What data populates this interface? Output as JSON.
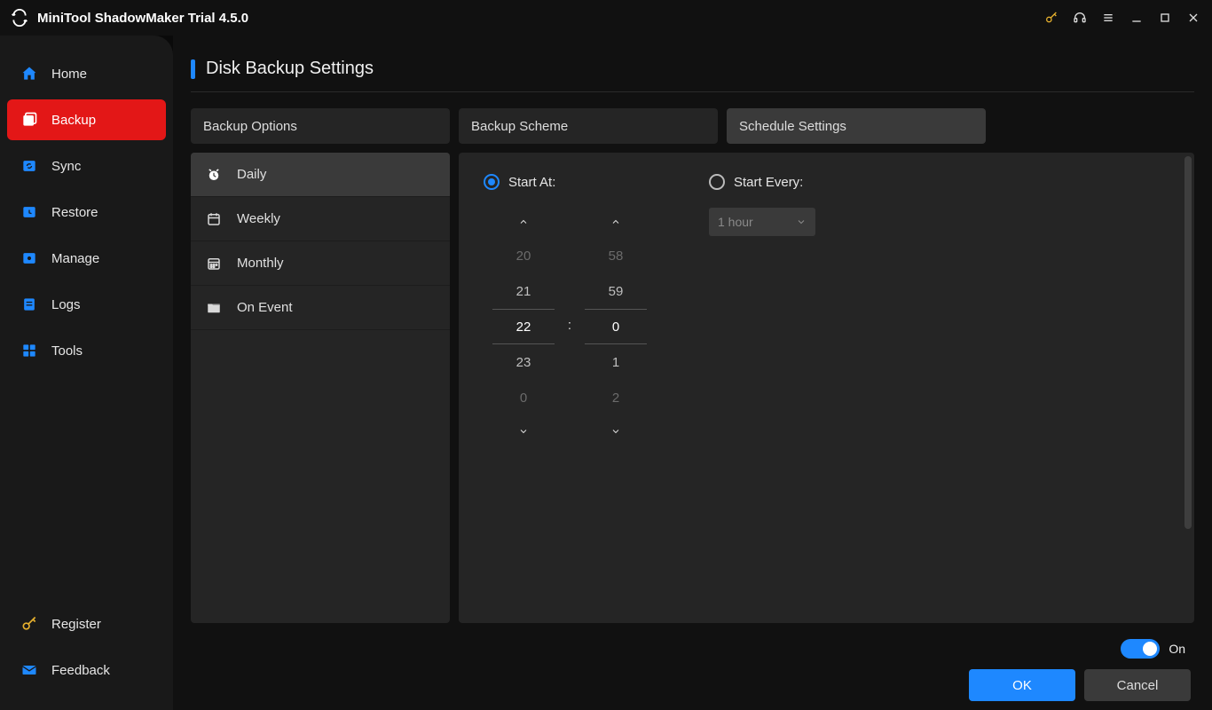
{
  "app": {
    "title": "MiniTool ShadowMaker Trial 4.5.0"
  },
  "sidebar": {
    "items": [
      {
        "label": "Home"
      },
      {
        "label": "Backup"
      },
      {
        "label": "Sync"
      },
      {
        "label": "Restore"
      },
      {
        "label": "Manage"
      },
      {
        "label": "Logs"
      },
      {
        "label": "Tools"
      }
    ],
    "bottom": [
      {
        "label": "Register"
      },
      {
        "label": "Feedback"
      }
    ]
  },
  "page": {
    "title": "Disk Backup Settings"
  },
  "tabs": [
    {
      "label": "Backup Options"
    },
    {
      "label": "Backup Scheme"
    },
    {
      "label": "Schedule Settings"
    }
  ],
  "frequency": [
    {
      "label": "Daily"
    },
    {
      "label": "Weekly"
    },
    {
      "label": "Monthly"
    },
    {
      "label": "On Event"
    }
  ],
  "schedule": {
    "start_at_label": "Start At:",
    "start_every_label": "Start Every:",
    "interval_selected": "1 hour",
    "hours": {
      "dim_prev": "20",
      "prev": "21",
      "sel": "22",
      "next": "23",
      "dim_next": "0"
    },
    "minutes": {
      "dim_prev": "58",
      "prev": "59",
      "sel": "0",
      "next": "1",
      "dim_next": "2"
    },
    "separator": ":"
  },
  "toggle": {
    "label": "On"
  },
  "buttons": {
    "ok": "OK",
    "cancel": "Cancel"
  }
}
